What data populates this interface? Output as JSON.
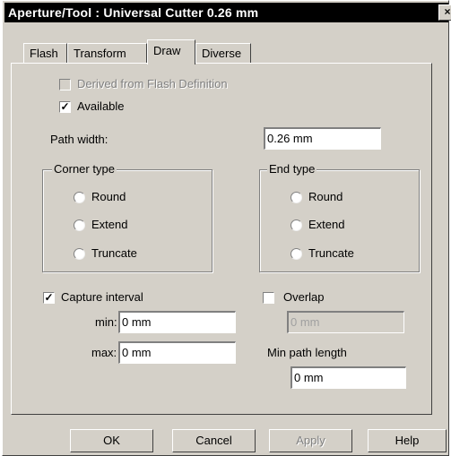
{
  "window": {
    "title": "Aperture/Tool : Universal Cutter 0.26 mm",
    "close_glyph": "×"
  },
  "tabs": [
    {
      "label": "Flash"
    },
    {
      "label": "Transform"
    },
    {
      "label": "Draw"
    },
    {
      "label": "Diverse"
    }
  ],
  "draw": {
    "derived_label": "Derived from Flash Definition",
    "available_label": "Available",
    "path_width_label": "Path width:",
    "path_width_value": "0.26 mm",
    "corner_type": {
      "legend": "Corner type",
      "options": [
        "Round",
        "Extend",
        "Truncate"
      ]
    },
    "end_type": {
      "legend": "End type",
      "options": [
        "Round",
        "Extend",
        "Truncate"
      ]
    },
    "capture_interval_label": "Capture interval",
    "min_label": "min:",
    "min_value": "0 mm",
    "max_label": "max:",
    "max_value": "0 mm",
    "overlap_label": "Overlap",
    "overlap_value": "0 mm",
    "min_path_length_label": "Min path length",
    "min_path_length_value": "0 mm",
    "check_glyph": "✓"
  },
  "buttons": {
    "ok": "OK",
    "cancel": "Cancel",
    "apply": "Apply",
    "help": "Help"
  }
}
